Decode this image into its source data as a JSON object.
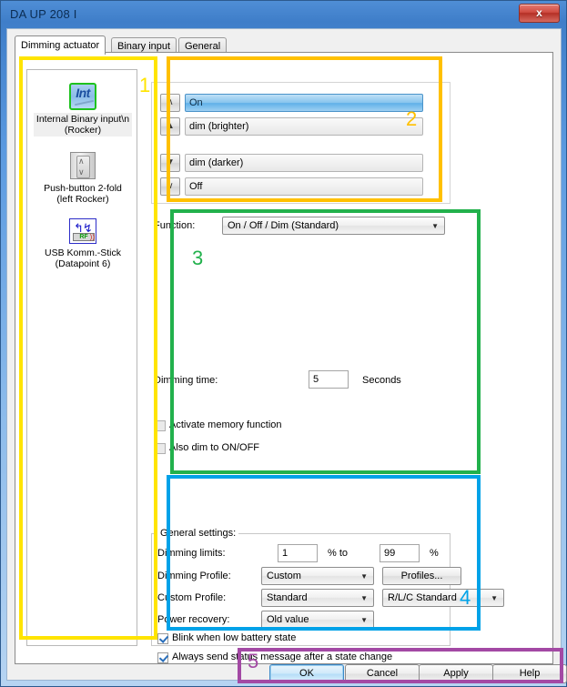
{
  "window": {
    "title": "DA UP 208 I",
    "close_label": "x",
    "close_icon": "close-icon"
  },
  "tabs": [
    {
      "label": "Dimming actuator",
      "active": true
    },
    {
      "label": "Binary input",
      "active": false
    },
    {
      "label": "General",
      "active": false
    }
  ],
  "device_list": [
    {
      "label": "Internal Binary input\\n (Rocker)",
      "icon": "int-binary-input-icon",
      "selected": true
    },
    {
      "label": "Push-button 2-fold (left Rocker)",
      "icon": "rocker-switch-icon",
      "selected": false
    },
    {
      "label": "USB Komm.-Stick (Datapoint 6)",
      "icon": "usb-stick-icon",
      "selected": false
    }
  ],
  "device_labels": {
    "item0_line1": "Internal Binary input\\n",
    "item0_line2": "(Rocker)",
    "item1_line1": "Push-button 2-fold",
    "item1_line2": "(left Rocker)",
    "item2_line1": "USB Komm.-Stick",
    "item2_line2": "(Datapoint 6)"
  },
  "channels": [
    {
      "value": "On",
      "button_icon": "chevron-up-thin-icon",
      "button_glyph": "∧",
      "selected": true
    },
    {
      "value": "dim (brighter)",
      "button_icon": "arrow-up-bold-icon",
      "button_glyph": "▲",
      "selected": false
    },
    {
      "value": "dim (darker)",
      "button_icon": "arrow-down-bold-icon",
      "button_glyph": "▼",
      "selected": false
    },
    {
      "value": "Off",
      "button_icon": "chevron-down-thin-icon",
      "button_glyph": "∨",
      "selected": false
    }
  ],
  "function_section": {
    "function_label": "Function:",
    "function_value": "On / Off / Dim (Standard)",
    "dimming_time_label": "Dimming time:",
    "dimming_time_value": "5",
    "seconds_label": "Seconds",
    "memory_checkbox_label": "Activate memory function",
    "memory_checkbox_checked": false,
    "also_dim_checkbox_label": "Also dim to ON/OFF",
    "also_dim_checkbox_checked": false
  },
  "general_settings": {
    "legend": "General settings:",
    "dimming_limits_label": "Dimming limits:",
    "dimming_limit_min": "1",
    "percent_to_label": "% to",
    "dimming_limit_max": "99",
    "percent_label": "%",
    "dimming_profile_label": "Dimming Profile:",
    "dimming_profile_value": "Custom",
    "profiles_button_label": "Profiles...",
    "custom_profile_label": "Custom Profile:",
    "custom_profile_value": "Standard",
    "rlc_value": "R/L/C Standard",
    "power_recovery_label": "Power recovery:",
    "power_recovery_value": "Old value",
    "blink_checkbox_label": "Blink when low battery state",
    "blink_checkbox_checked": true,
    "status_checkbox_label": "Always send status message after a state change",
    "status_checkbox_checked": true
  },
  "buttons": {
    "ok": "OK",
    "cancel": "Cancel",
    "apply": "Apply",
    "help": "Help"
  },
  "annotations": [
    {
      "number": "1",
      "color": "#ffe400"
    },
    {
      "number": "2",
      "color": "#ffc000"
    },
    {
      "number": "3",
      "color": "#22b14c"
    },
    {
      "number": "4",
      "color": "#00a2e8"
    },
    {
      "number": "5",
      "color": "#a349a4"
    }
  ]
}
